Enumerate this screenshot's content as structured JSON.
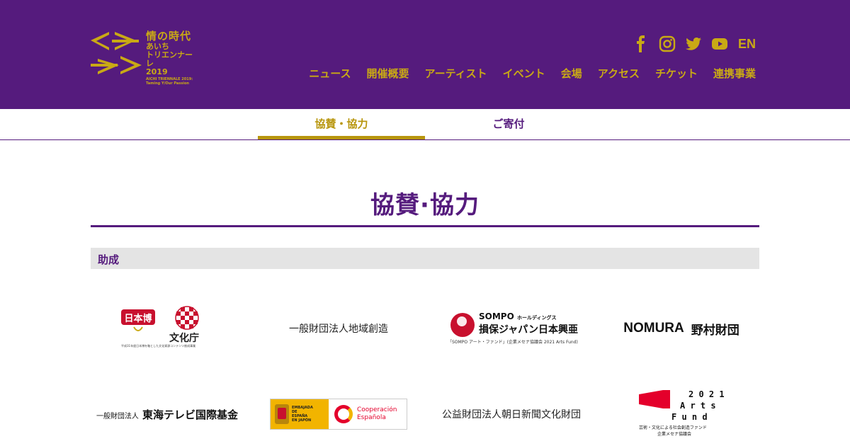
{
  "header": {
    "logo": {
      "title": "情の時代",
      "line1": "あいち",
      "line2": "トリエンナーレ",
      "year": "2019",
      "en_line1": "AICHI TRIENNALE 2019:",
      "en_line2": "Taming Y/Our Passion"
    },
    "social": {
      "facebook": "facebook-icon",
      "instagram": "instagram-icon",
      "twitter": "twitter-icon",
      "youtube": "youtube-icon",
      "language": "EN"
    },
    "nav": [
      {
        "label": "ニュース"
      },
      {
        "label": "開催概要"
      },
      {
        "label": "アーティスト"
      },
      {
        "label": "イベント"
      },
      {
        "label": "会場"
      },
      {
        "label": "アクセス"
      },
      {
        "label": "チケット"
      },
      {
        "label": "連携事業"
      }
    ]
  },
  "tabs": [
    {
      "label": "協賛・協力",
      "active": true
    },
    {
      "label": "ご寄付",
      "active": false
    }
  ],
  "page": {
    "title": "協賛·協力",
    "section": "助成"
  },
  "sponsors": {
    "bunka": {
      "small": "平成31年度日本博を軸とした文化資源コンテンツ創成事業"
    },
    "chiiki": "一般財団法人地域創造",
    "sompo": {
      "line1": "SOMPO",
      "line1_small": "ホールディングス",
      "line2": "損保ジャパン日本興亜",
      "line3": "「SOMPO アート・ファンド」(企業メセナ協議会 2021 Arts Fund)"
    },
    "nomura": {
      "en": "NOMURA",
      "jp": "野村財団"
    },
    "tokai": {
      "small": "一般財団法人",
      "big": "東海テレビ国際基金"
    },
    "spain": {
      "embassy": [
        "EMBAJADA",
        "DE",
        "ESPAÑA",
        "EN JAPÓN"
      ],
      "coop1": "Cooperación",
      "coop2": "Española"
    },
    "asahi": "公益財団法人朝日新聞文化財団",
    "arts_fund": {
      "small1": "芸術・文化による社会創造ファンド",
      "small2": "企業メセナ協議会"
    }
  },
  "colors": {
    "brand_purple": "#551b7d",
    "gold": "#c9a915",
    "section_bg": "#e4e4e4"
  }
}
